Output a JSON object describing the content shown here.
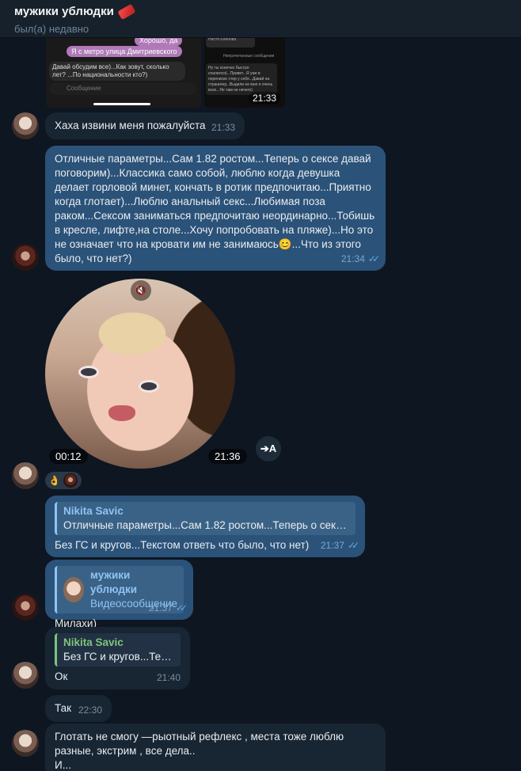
{
  "header": {
    "chat_title": "мужики ублюдки",
    "status": "был(а) недавно"
  },
  "screenshot_preview": {
    "left_pill_1": "Хорошо, да",
    "left_pill_2": "Я с метро улица Дмитриевского",
    "left_msg": "Давай обсудим все)...Как зовут, сколько лет? ...По национальности кто?)",
    "left_input_placeholder": "Сообщение",
    "right_top": "Настя Блинова",
    "right_divider": "Непрочитанные сообщения",
    "right_msg": "Ну ты конечно быстро спалился)...Привет...Я уже в переписке стер у себя...Давай на страничку...Выдели не мне я очень всех...Не там не нечего)",
    "time": "21:33"
  },
  "messages": [
    {
      "text": "Хаха извини меня пожалуйста",
      "time": "21:33"
    },
    {
      "text": "Отличные параметры...Сам 1.82 ростом...Теперь о сексе давай поговорим)...Классика само собой, люблю когда девушка делает горловой минет, кончать в ротик предпочитаю...Приятно когда глотает)...Люблю анальный секс...Любимая поза раком...Сексом заниматься предпочитаю неординарно...Тобишь в кресле, лифте,на столе...Хочу попробовать на пляже)...Но это не означает что на кровати им не занимаюсь😊...Что из этого было, что нет?)",
      "time": "21:34"
    },
    {
      "video_duration": "00:12",
      "time": "21:36",
      "translate_label": "➔A"
    },
    {
      "reply_name": "Nikita Savic",
      "reply_text": "Отличные параметры...Сам 1.82 ростом...Теперь о сексе ...",
      "text": "Без ГС и кругов...Текстом ответь что было, что нет)",
      "time": "21:37"
    },
    {
      "reply_name": "мужики ублюдки",
      "reply_text": "Видеосообщение",
      "text": "Милахи)",
      "time": "21:37"
    },
    {
      "reply_name": "Nikita Savic",
      "reply_text": "Без ГС и кругов...Текс...",
      "text": "Ок",
      "time": "21:40"
    },
    {
      "text": "Так",
      "time": "22:30"
    },
    {
      "text": "Глотать не смогу —рыотный рефлекс , места тоже люблю разные, экстрим , все дела..",
      "text2": "И..."
    }
  ],
  "reaction_emoji": "👌",
  "colors": {
    "background": "#0e1621",
    "incoming_bubble": "#182533",
    "outgoing_bubble": "#2b5278",
    "read_checks": "#5fa8ea"
  }
}
